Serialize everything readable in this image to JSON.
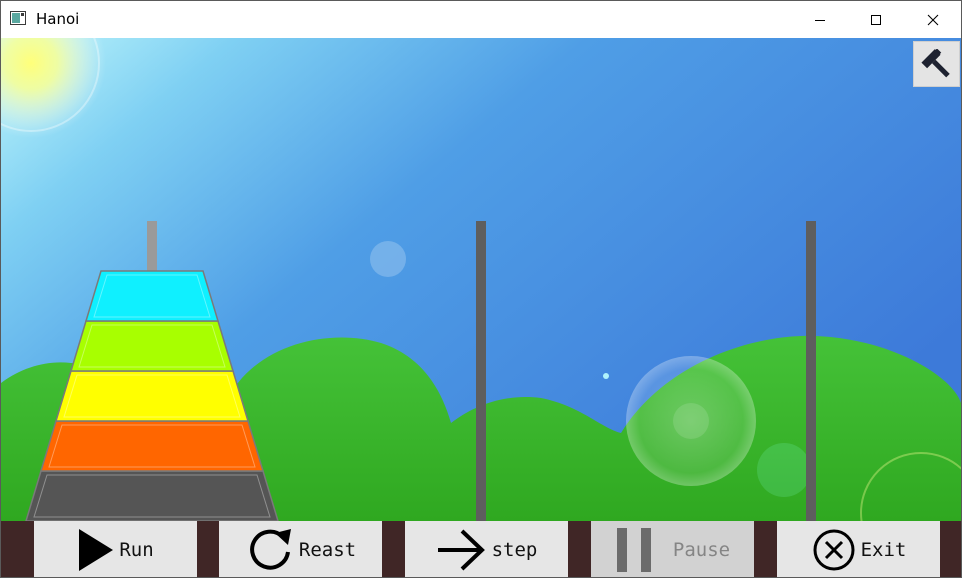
{
  "window": {
    "title": "Hanoi"
  },
  "corner_button": {
    "icon": "hammer-icon"
  },
  "scene": {
    "pegs": [
      {
        "name": "peg-left"
      },
      {
        "name": "peg-middle"
      },
      {
        "name": "peg-right"
      }
    ],
    "disks": [
      {
        "peg": 1,
        "level": 1,
        "color": "#555555"
      },
      {
        "peg": 1,
        "level": 2,
        "color": "#ff6600"
      },
      {
        "peg": 1,
        "level": 3,
        "color": "#ffff00"
      },
      {
        "peg": 1,
        "level": 4,
        "color": "#a8ff00"
      },
      {
        "peg": 1,
        "level": 5,
        "color": "#0ff0ff"
      }
    ],
    "colors": {
      "sky_top": "#9fe9f8",
      "sky_bottom": "#3b7ed8",
      "hill": "#3cb82e",
      "peg": "#5e5e5e"
    }
  },
  "toolbar": {
    "run_label": "Run",
    "reset_label": "Reast",
    "step_label": "step",
    "pause_label": "Pause",
    "exit_label": "Exit",
    "pause_enabled": false,
    "background": "#402626"
  }
}
